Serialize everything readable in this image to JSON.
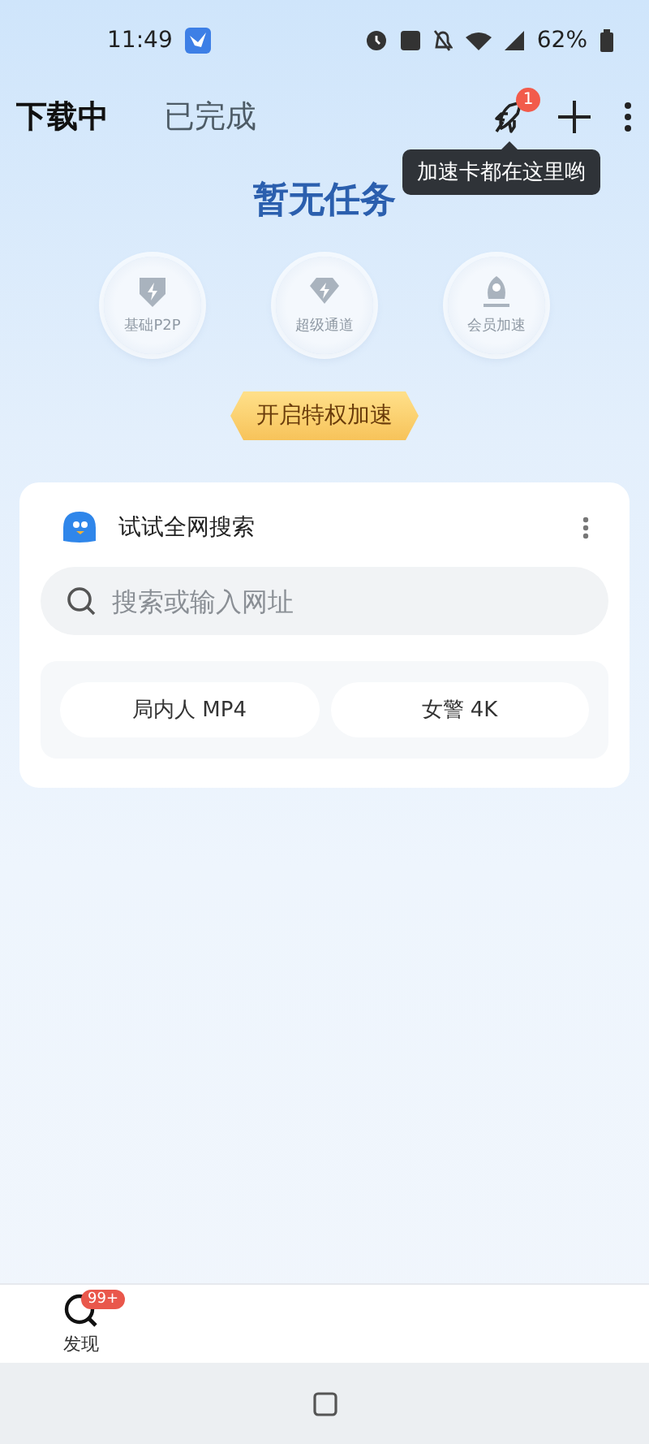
{
  "status_bar": {
    "time": "11:49",
    "battery": "62%"
  },
  "tabs": [
    {
      "label": "下载中",
      "selected": true
    },
    {
      "label": "已完成",
      "selected": false
    }
  ],
  "header_actions": {
    "badge": "1",
    "tooltip": "加速卡都在这里哟"
  },
  "empty_title": "暂无任务",
  "features": [
    {
      "label": "基础P2P",
      "kind": "shield"
    },
    {
      "label": "超级通道",
      "kind": "diamond"
    },
    {
      "label": "会员加速",
      "kind": "rocket"
    }
  ],
  "boost_button": "开启特权加速",
  "search_card": {
    "title": "试试全网搜索",
    "placeholder": "搜索或输入网址",
    "chips": [
      "局内人 MP4",
      "女警 4K"
    ]
  },
  "bottom_nav": [
    {
      "label": "发现",
      "badge": "99+"
    }
  ]
}
